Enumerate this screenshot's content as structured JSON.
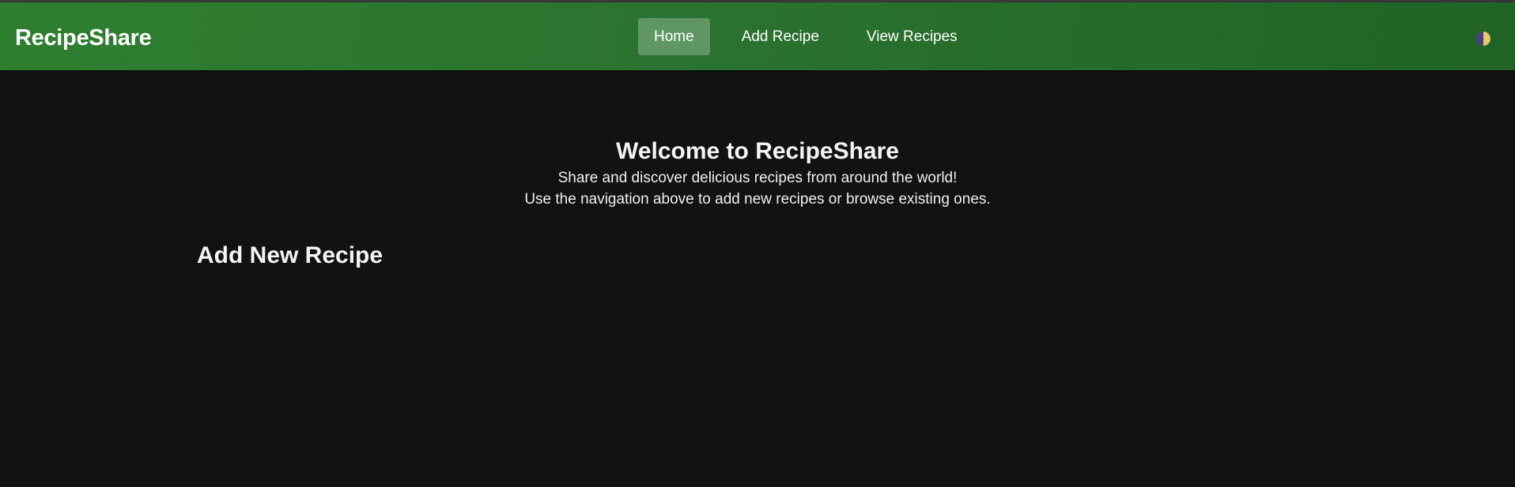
{
  "header": {
    "brand": "RecipeShare",
    "nav": [
      {
        "label": "Home",
        "active": true
      },
      {
        "label": "Add Recipe",
        "active": false
      },
      {
        "label": "View Recipes",
        "active": false
      }
    ],
    "theme_toggle_icon": "half-moon-theme-icon"
  },
  "hero": {
    "title": "Welcome to RecipeShare",
    "line1": "Share and discover delicious recipes from around the world!",
    "line2": "Use the navigation above to add new recipes or browse existing ones."
  },
  "main": {
    "section_title": "Add New Recipe"
  },
  "colors": {
    "header_green": "#2b7330",
    "background": "#121212",
    "text": "#f2f2f2"
  }
}
